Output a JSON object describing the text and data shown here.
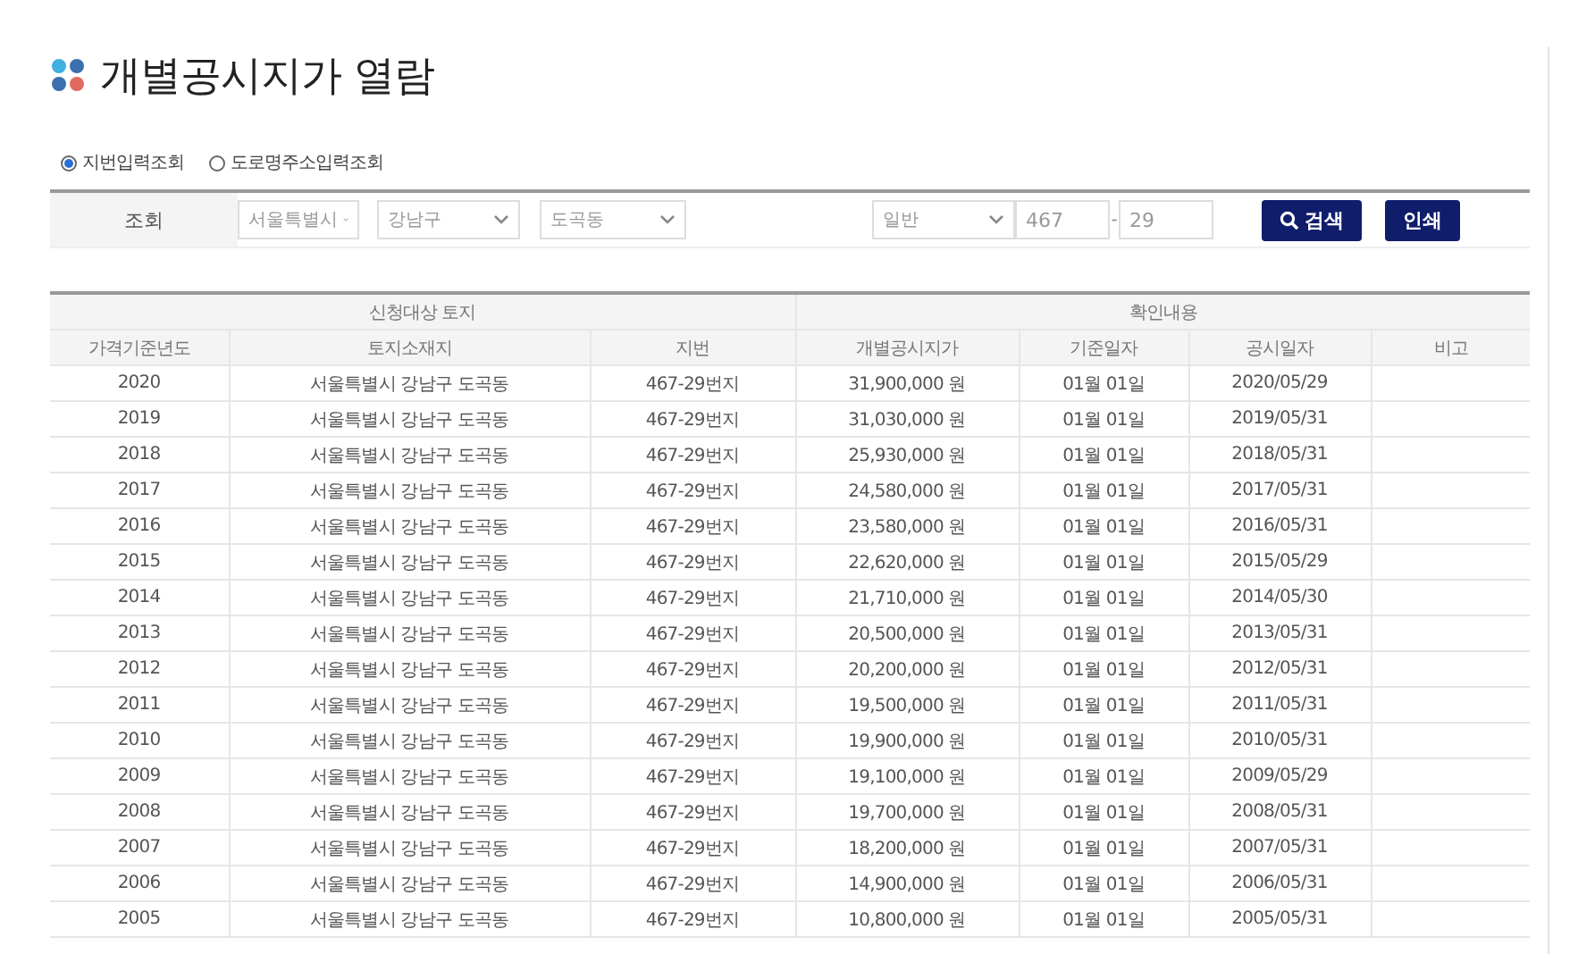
{
  "page_title": "개별공시지가 열람",
  "search_modes": [
    {
      "label": "지번입력조회",
      "selected": true
    },
    {
      "label": "도로명주소입력조회",
      "selected": false
    }
  ],
  "query": {
    "label": "조회",
    "city": "서울특별시",
    "district": "강남구",
    "dong": "도곡동",
    "land_type": "일반",
    "main_number": "467",
    "separator": "-",
    "sub_number": "29",
    "search_button": "검색",
    "print_button": "인쇄"
  },
  "table": {
    "groups": [
      {
        "label": "신청대상 토지",
        "columns": [
          "가격기준년도",
          "토지소재지",
          "지번"
        ]
      },
      {
        "label": "확인내용",
        "columns": [
          "개별공시지가",
          "기준일자",
          "공시일자",
          "비고"
        ]
      }
    ],
    "rows": [
      [
        "2020",
        "서울특별시 강남구 도곡동",
        "467-29번지",
        "31,900,000 원",
        "01월 01일",
        "2020/05/29"
      ],
      [
        "2019",
        "서울특별시 강남구 도곡동",
        "467-29번지",
        "31,030,000 원",
        "01월 01일",
        "2019/05/31"
      ],
      [
        "2018",
        "서울특별시 강남구 도곡동",
        "467-29번지",
        "25,930,000 원",
        "01월 01일",
        "2018/05/31"
      ],
      [
        "2017",
        "서울특별시 강남구 도곡동",
        "467-29번지",
        "24,580,000 원",
        "01월 01일",
        "2017/05/31"
      ],
      [
        "2016",
        "서울특별시 강남구 도곡동",
        "467-29번지",
        "23,580,000 원",
        "01월 01일",
        "2016/05/31"
      ],
      [
        "2015",
        "서울특별시 강남구 도곡동",
        "467-29번지",
        "22,620,000 원",
        "01월 01일",
        "2015/05/29"
      ],
      [
        "2014",
        "서울특별시 강남구 도곡동",
        "467-29번지",
        "21,710,000 원",
        "01월 01일",
        "2014/05/30"
      ],
      [
        "2013",
        "서울특별시 강남구 도곡동",
        "467-29번지",
        "20,500,000 원",
        "01월 01일",
        "2013/05/31"
      ],
      [
        "2012",
        "서울특별시 강남구 도곡동",
        "467-29번지",
        "20,200,000 원",
        "01월 01일",
        "2012/05/31"
      ],
      [
        "2011",
        "서울특별시 강남구 도곡동",
        "467-29번지",
        "19,500,000 원",
        "01월 01일",
        "2011/05/31"
      ],
      [
        "2010",
        "서울특별시 강남구 도곡동",
        "467-29번지",
        "19,900,000 원",
        "01월 01일",
        "2010/05/31"
      ],
      [
        "2009",
        "서울특별시 강남구 도곡동",
        "467-29번지",
        "19,100,000 원",
        "01월 01일",
        "2009/05/29"
      ],
      [
        "2008",
        "서울특별시 강남구 도곡동",
        "467-29번지",
        "19,700,000 원",
        "01월 01일",
        "2008/05/31"
      ],
      [
        "2007",
        "서울특별시 강남구 도곡동",
        "467-29번지",
        "18,200,000 원",
        "01월 01일",
        "2007/05/31"
      ],
      [
        "2006",
        "서울특별시 강남구 도곡동",
        "467-29번지",
        "14,900,000 원",
        "01월 01일",
        "2006/05/31"
      ],
      [
        "2005",
        "서울특별시 강남구 도곡동",
        "467-29번지",
        "10,800,000 원",
        "01월 01일",
        "2005/05/31"
      ]
    ]
  }
}
